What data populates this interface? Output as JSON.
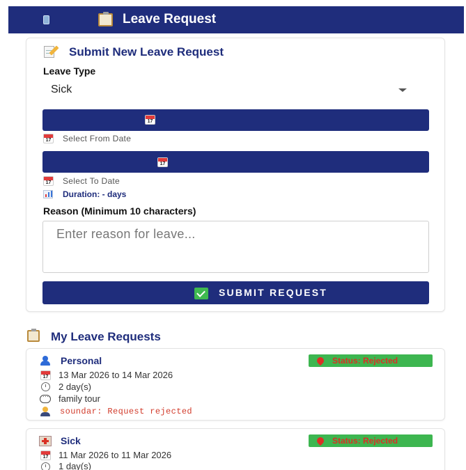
{
  "header": {
    "title": "Leave Request",
    "icons": [
      "mobile-phone-icon",
      "clipboard-icon"
    ]
  },
  "form": {
    "title": "Submit New Leave Request",
    "leave_type_label": "Leave Type",
    "leave_type_value": "Sick",
    "from_date_hint": "Select From Date",
    "to_date_hint": "Select To Date",
    "calendar_day": "17",
    "duration": "Duration: - days",
    "reason_label": "Reason (Minimum 10 characters)",
    "reason_placeholder": "Enter reason for leave...",
    "submit_label": "SUBMIT REQUEST"
  },
  "list": {
    "title": "My Leave Requests",
    "requests": [
      {
        "type": "Personal",
        "status": "Status: Rejected",
        "dates": "13 Mar 2026 to 14 Mar 2026",
        "days": "2 day(s)",
        "reason": "family tour",
        "admin_note": "soundar: Request rejected"
      },
      {
        "type": "Sick",
        "status": "Status: Rejected",
        "dates": "11 Mar 2026 to 11 Mar 2026",
        "days": "1 day(s)"
      }
    ]
  },
  "colors": {
    "primary": "#1f2d7c",
    "badge": "#3db650",
    "danger": "#d93025"
  }
}
